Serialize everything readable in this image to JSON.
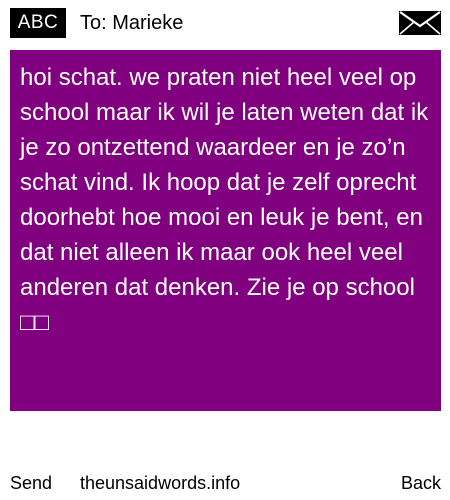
{
  "header": {
    "mode_label": "ABC",
    "recipient": "To: Marieke",
    "mail_icon": "envelope-icon"
  },
  "message": {
    "text": "hoi schat. we praten niet heel veel op school maar ik wil je laten weten dat ik je zo ontzettend waardeer en je zo’n schat vind. Ik hoop dat je zelf oprecht doorhebt hoe mooi en leuk je bent, en dat niet alleen ik maar ook heel veel anderen dat denken. Zie je op school □□",
    "background_color": "#800080",
    "text_color": "#ffffff"
  },
  "footer": {
    "send_label": "Send",
    "site_label": "theunsaidwords.info",
    "back_label": "Back"
  }
}
